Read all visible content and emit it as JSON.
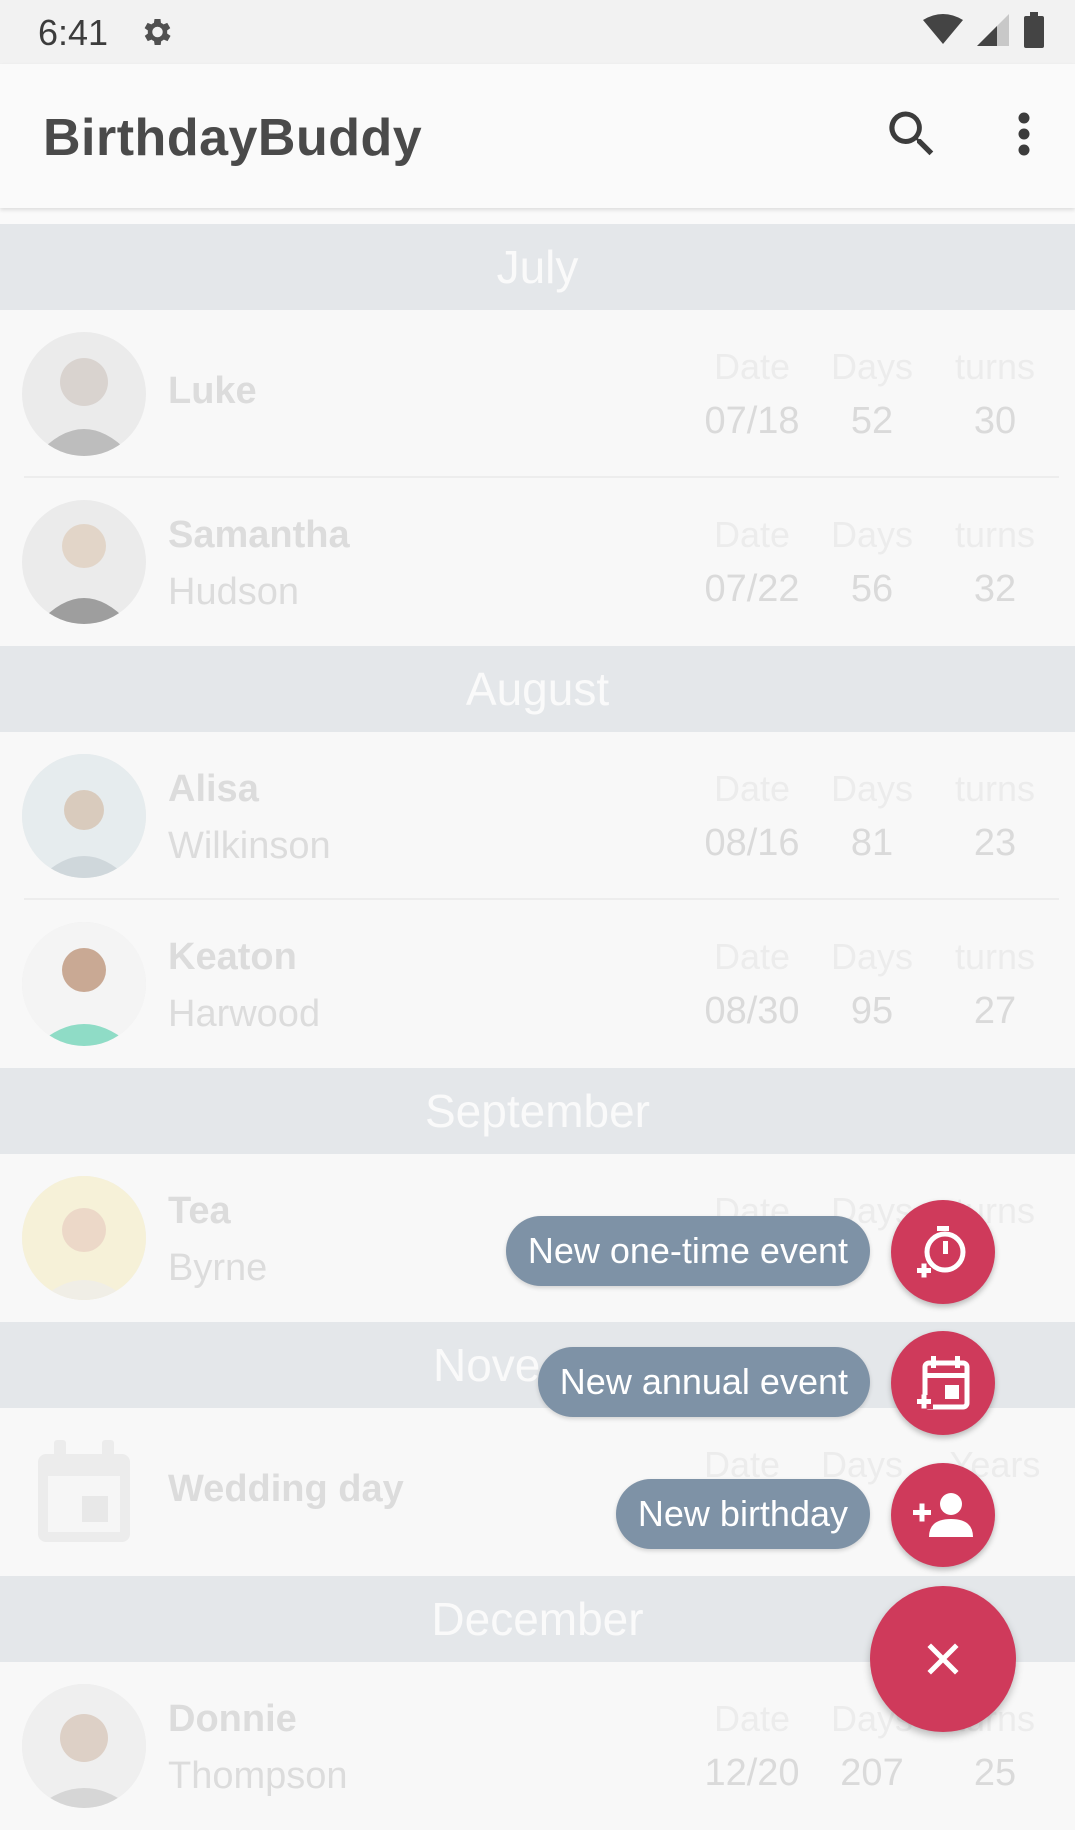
{
  "status_bar": {
    "time": "6:41"
  },
  "app_bar": {
    "title": "BirthdayBuddy"
  },
  "columns": {
    "date": "Date",
    "days": "Days",
    "turns": "turns",
    "years": "Years"
  },
  "months": [
    {
      "name": "July",
      "entries": [
        {
          "first": "Luke",
          "last": "",
          "date": "07/18",
          "days": "52",
          "age": "30"
        },
        {
          "first": "Samantha",
          "last": "Hudson",
          "date": "07/22",
          "days": "56",
          "age": "32"
        }
      ]
    },
    {
      "name": "August",
      "entries": [
        {
          "first": "Alisa",
          "last": "Wilkinson",
          "date": "08/16",
          "days": "81",
          "age": "23"
        },
        {
          "first": "Keaton",
          "last": "Harwood",
          "date": "08/30",
          "days": "95",
          "age": "27"
        }
      ]
    },
    {
      "name": "September",
      "entries": [
        {
          "first": "Tea",
          "last": "Byrne",
          "date": "",
          "days": "",
          "age": ""
        }
      ]
    },
    {
      "name": "Nove",
      "entries": [
        {
          "first": "Wedding day",
          "last": "",
          "date": "",
          "days": "",
          "age": ""
        }
      ]
    },
    {
      "name": "December",
      "entries": [
        {
          "first": "Donnie",
          "last": "Thompson",
          "date": "12/20",
          "days": "207",
          "age": "25"
        }
      ]
    }
  ],
  "fab_menu": {
    "one_time": "New one-time event",
    "annual": "New annual event",
    "birthday": "New birthday"
  },
  "colors": {
    "accent": "#cf3a5b",
    "label_bg": "#7e92a6",
    "header_bg": "#e4e7ea"
  }
}
